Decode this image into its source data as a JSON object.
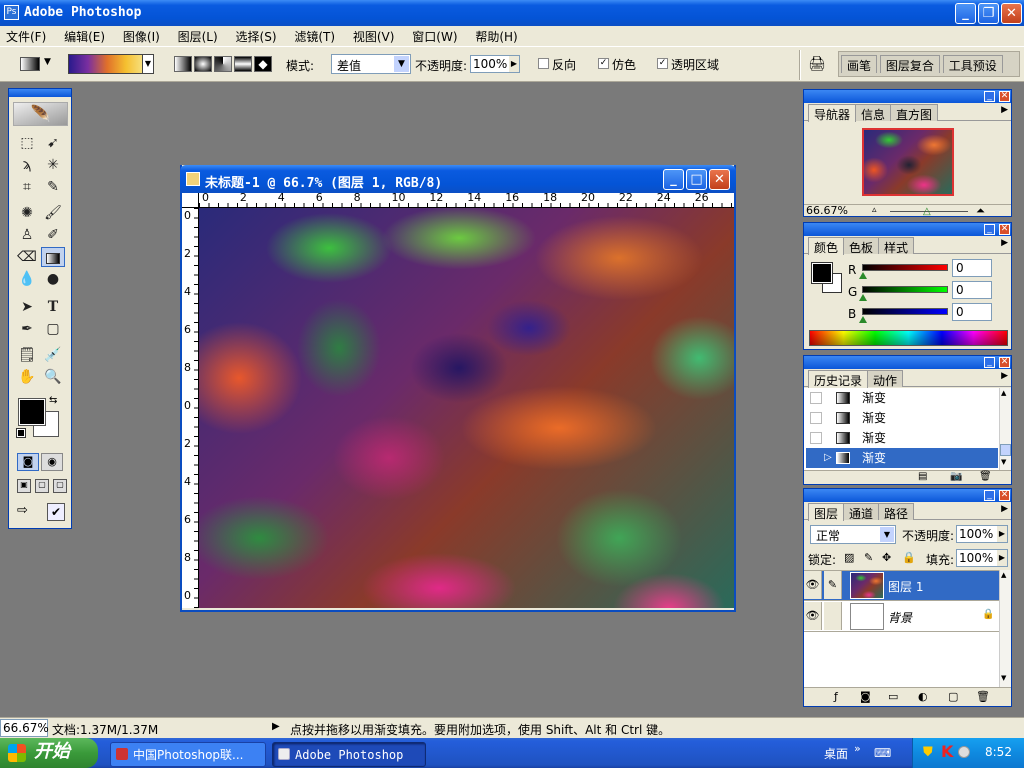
{
  "app": {
    "title": "Adobe Photoshop"
  },
  "menu": [
    "文件(F)",
    "编辑(E)",
    "图像(I)",
    "图层(L)",
    "选择(S)",
    "滤镜(T)",
    "视图(V)",
    "窗口(W)",
    "帮助(H)"
  ],
  "options": {
    "mode_label": "模式:",
    "mode_value": "差值",
    "opacity_label": "不透明度:",
    "opacity_value": "100%",
    "reverse": "反向",
    "dither": "仿色",
    "transparency": "透明区域",
    "reverse_checked": false,
    "dither_checked": true,
    "transparency_checked": true
  },
  "palette_well": {
    "tabs": [
      "画笔",
      "图层复合",
      "工具预设"
    ]
  },
  "document": {
    "title": "未标题-1 @ 66.7% (图层 1, RGB/8)",
    "ruler_top": [
      "0",
      "2",
      "4",
      "6",
      "8",
      "10",
      "12",
      "14",
      "16",
      "18",
      "20",
      "22",
      "24",
      "26"
    ],
    "ruler_left": [
      "0",
      "2",
      "4",
      "6",
      "8",
      "0",
      "2",
      "4",
      "6",
      "8",
      "0"
    ]
  },
  "navigator": {
    "tabs": [
      "导航器",
      "信息",
      "直方图"
    ],
    "zoom": "66.67%"
  },
  "color": {
    "tabs": [
      "颜色",
      "色板",
      "样式"
    ],
    "channels": [
      {
        "label": "R",
        "value": "0"
      },
      {
        "label": "G",
        "value": "0"
      },
      {
        "label": "B",
        "value": "0"
      }
    ],
    "foreground": "#000000",
    "background": "#ffffff"
  },
  "history": {
    "tabs": [
      "历史记录",
      "动作"
    ],
    "items": [
      "渐变",
      "渐变",
      "渐变",
      "渐变"
    ],
    "selected_index": 3
  },
  "layers": {
    "tabs": [
      "图层",
      "通道",
      "路径"
    ],
    "blend_mode": "正常",
    "opacity_label": "不透明度:",
    "opacity_value": "100%",
    "lock_label": "锁定:",
    "fill_label": "填充:",
    "fill_value": "100%",
    "items": [
      {
        "name": "图层 1",
        "selected": true
      },
      {
        "name": "背景",
        "selected": false,
        "locked": true
      }
    ]
  },
  "status": {
    "zoom": "66.67%",
    "doc": "文档:1.37M/1.37M",
    "hint": "点按并拖移以用渐变填充。要用附加选项，使用 Shift、Alt 和 Ctrl 键。"
  },
  "taskbar": {
    "start": "开始",
    "tasks": [
      "中国Photoshop联...",
      "Adobe Photoshop"
    ],
    "desktop": "桌面",
    "time": "8:52"
  },
  "colors": {
    "xp_blue": "#0a5be0",
    "panel": "#ece9d8",
    "workspace": "#7a7a7a",
    "selection": "#316ac5"
  }
}
